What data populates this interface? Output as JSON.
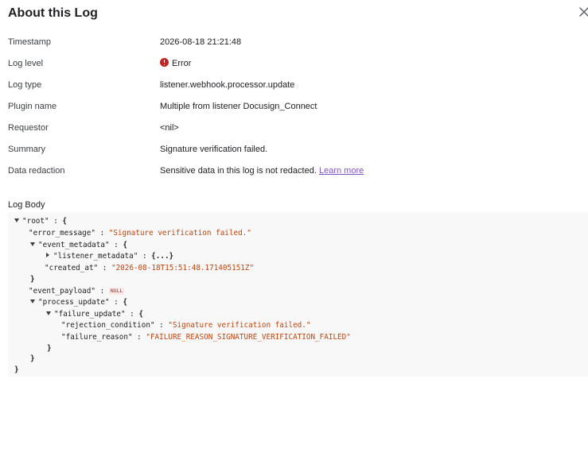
{
  "dialog": {
    "title": "About this Log",
    "close_icon": "close-icon"
  },
  "properties": {
    "timestamp_label": "Timestamp",
    "timestamp_value": "2026-08-18 21:21:48",
    "log_level_label": "Log level",
    "log_level_value": "Error",
    "log_level_icon": "error-icon",
    "log_level_color": "#c5221f",
    "log_type_label": "Log type",
    "log_type_value": "listener.webhook.processor.update",
    "plugin_name_label": "Plugin name",
    "plugin_name_value": "Multiple from listener Docusign_Connect",
    "requestor_label": "Requestor",
    "requestor_value": "<nil>",
    "summary_label": "Summary",
    "summary_value": "Signature verification failed.",
    "data_redaction_label": "Data redaction",
    "data_redaction_value": "Sensitive data in this log is not redacted.",
    "learn_more_link": "Learn more",
    "link_color": "#7e57c2"
  },
  "log_body": {
    "title": "Log Body",
    "root_key": "\"root\"",
    "error_message_key": "\"error_message\"",
    "error_message_value": "\"Signature verification failed.\"",
    "event_metadata_key": "\"event_metadata\"",
    "listener_metadata_key": "\"listener_metadata\"",
    "listener_metadata_collapsed": "{...}",
    "created_at_key": "\"created_at\"",
    "created_at_value": "\"2026-08-18T15:51:48.171405151Z\"",
    "event_payload_key": "\"event_payload\"",
    "event_payload_value": "NULL",
    "process_update_key": "\"process_update\"",
    "failure_update_key": "\"failure_update\"",
    "rejection_condition_key": "\"rejection_condition\"",
    "rejection_condition_value": "\"Signature verification failed.\"",
    "failure_reason_key": "\"failure_reason\"",
    "failure_reason_value": "\"FAILURE_REASON_SIGNATURE_VERIFICATION_FAILED\"",
    "string_color": "#c1440e"
  }
}
